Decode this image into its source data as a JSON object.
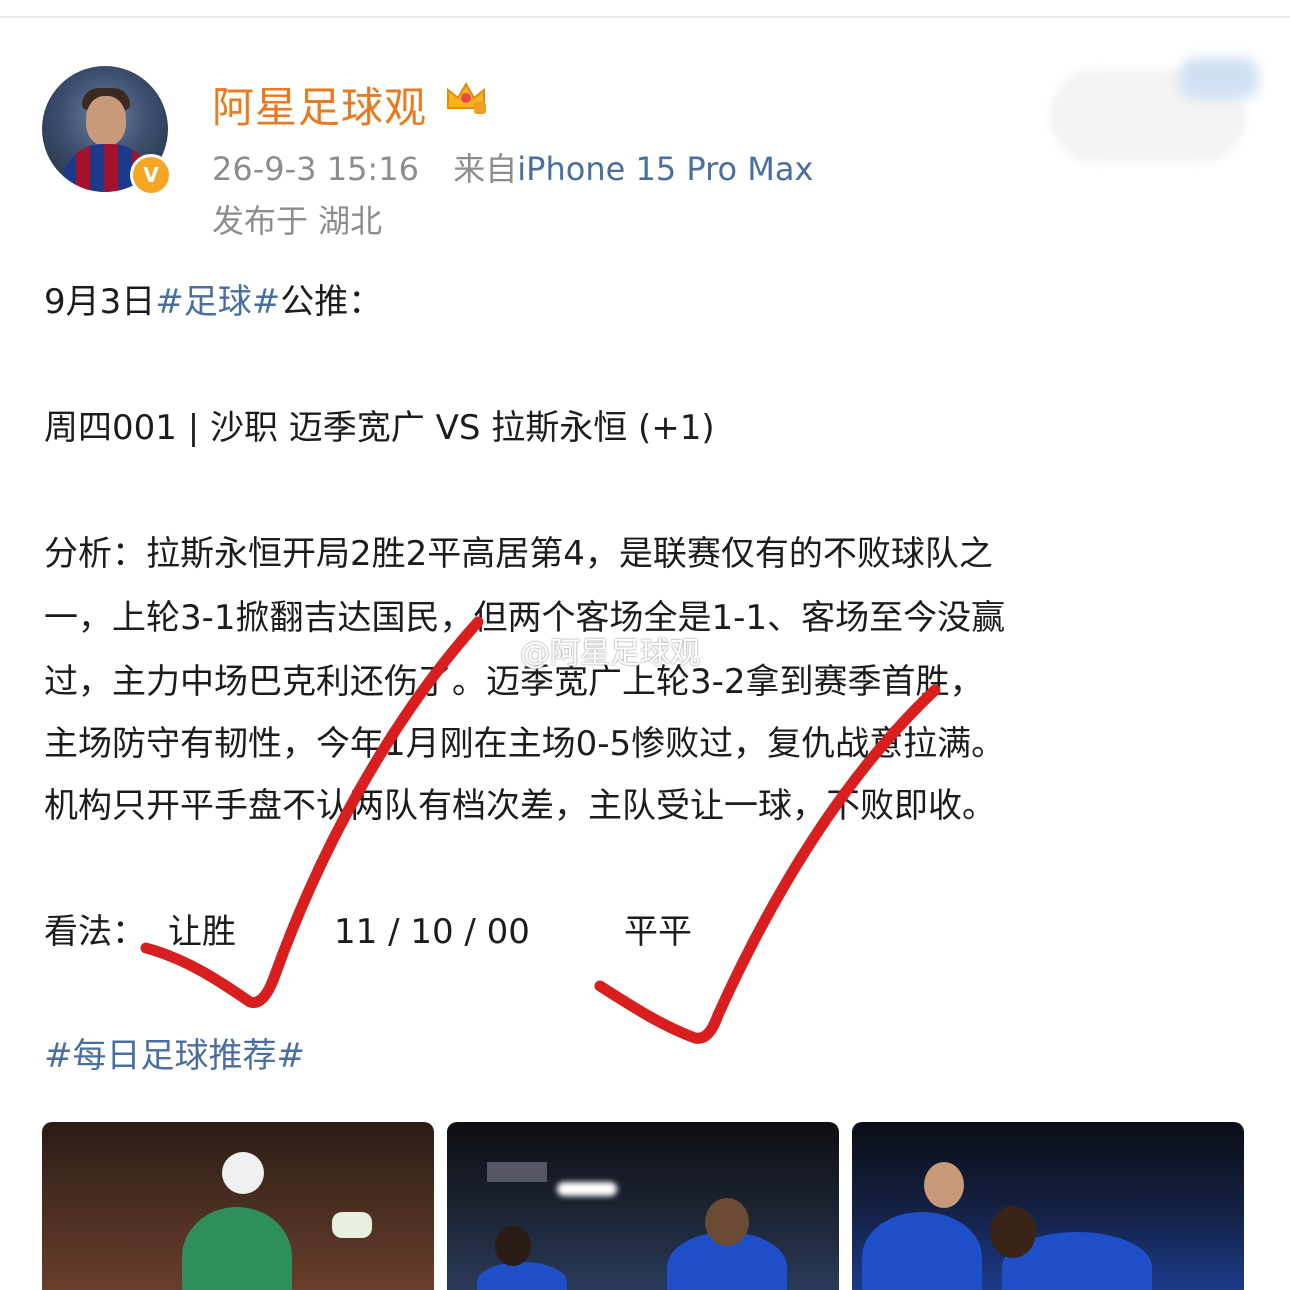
{
  "post": {
    "author": "阿星足球观",
    "time": "26-9-3 15:16",
    "source_prefix": "来自",
    "device": "iPhone 15 Pro Max",
    "location": "发布于 湖北",
    "verified_badge": "V"
  },
  "content": {
    "l1_pre": "9月3日",
    "l1_tag": "#足球#",
    "l1_post": "公推：",
    "l2": "周四001 | 沙职 迈季宽广 VS 拉斯永恒 (+1)",
    "l3": "分析：拉斯永恒开局2胜2平高居第4，是联赛仅有的不败球队之",
    "l4": "一，上轮3-1掀翻吉达国民，但两个客场全是1-1、客场至今没赢",
    "l5": "过，主力中场巴克利还伤了。迈季宽广上轮3-2拿到赛季首胜，",
    "l6": "主场防守有韧性，今年1月刚在主场0-5惨败过，复仇战意拉满。",
    "l7": "机构只开平手盘不认两队有档次差，主队受让一球，不败即收。",
    "view_label": "看法：",
    "view_pick": "让胜",
    "view_score": "11 / 10 / 00",
    "view_extra": "平平",
    "hashtag": "#每日足球推荐#"
  },
  "watermark": "@阿星足球观",
  "colors": {
    "username": "#eb7a1e",
    "link": "#4a6ea0",
    "meta": "#8d8d8d",
    "checkmark": "#d81e1e"
  },
  "icons": [
    "crown-badge-icon",
    "verified-badge-icon",
    "checkmark-icon"
  ]
}
